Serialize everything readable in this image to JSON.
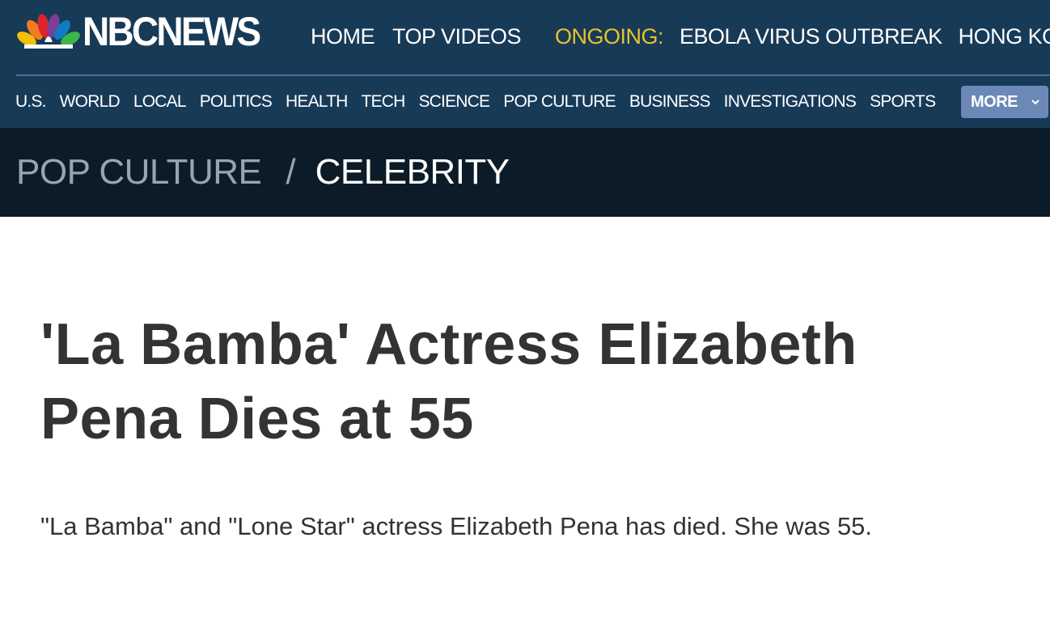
{
  "brand": {
    "logo_text": "NBCNEWS",
    "peacock_colors": [
      "#f5c000",
      "#f47a20",
      "#d9262c",
      "#7b3f98",
      "#0e7cc1",
      "#3cb54a"
    ]
  },
  "top_nav": {
    "items": [
      "HOME",
      "TOP VIDEOS"
    ],
    "ongoing_label": "ONGOING:",
    "ongoing_items": [
      "EBOLA VIRUS OUTBREAK",
      "HONG KONG"
    ]
  },
  "section_nav": {
    "items": [
      "U.S.",
      "WORLD",
      "LOCAL",
      "POLITICS",
      "HEALTH",
      "TECH",
      "SCIENCE",
      "POP CULTURE",
      "BUSINESS",
      "INVESTIGATIONS",
      "SPORTS"
    ],
    "more_label": "MORE"
  },
  "breadcrumb": {
    "parent": "POP CULTURE",
    "separator": "/",
    "current": "CELEBRITY"
  },
  "article": {
    "headline": "'La Bamba' Actress Elizabeth Pena Dies at 55",
    "summary": "\"La Bamba\" and \"Lone Star\" actress Elizabeth Pena has died. She was 55."
  },
  "colors": {
    "header_bg": "#173a57",
    "breadcrumb_bg": "#0b1c28",
    "ongoing_accent": "#e8c32a",
    "more_button_bg": "#6b88b6",
    "text_dark": "#333333"
  }
}
